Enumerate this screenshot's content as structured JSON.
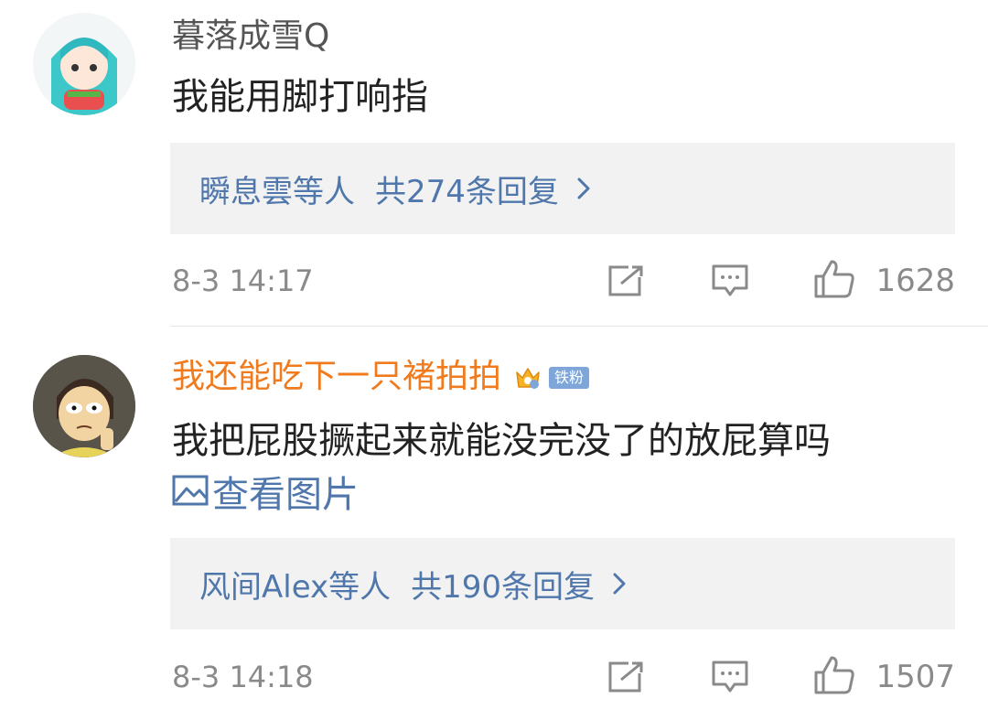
{
  "comments": [
    {
      "username": "暮落成雪Q",
      "text": "我能用脚打响指",
      "reply_preview": {
        "who": "瞬息雲等人",
        "total": "共274条回复"
      },
      "time": "8-3 14:17",
      "likes": "1628"
    },
    {
      "username": "我还能吃下一只褚拍拍",
      "fan_badge": "铁粉",
      "text": "我把屁股撅起来就能没完没了的放屁算吗",
      "view_picture": "查看图片",
      "reply_preview": {
        "who": "风间Alex等人",
        "total": "共190条回复"
      },
      "time": "8-3 14:18",
      "likes": "1507"
    }
  ],
  "colors": {
    "link_blue": "#4f77ab",
    "vip_orange": "#f07b1f",
    "gray_text": "#8a8a8a"
  }
}
